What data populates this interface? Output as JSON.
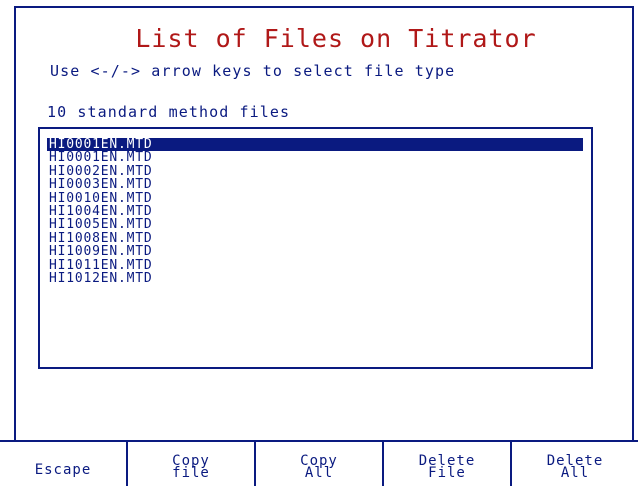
{
  "header": {
    "title": "List of Files on Titrator",
    "instructions": "Use <-/-> arrow keys to select file type"
  },
  "file_panel": {
    "count_label": "10 standard method files",
    "files": [
      "HI0001EN.MTD",
      "HI0001EN.MTD",
      "HI0002EN.MTD",
      "HI0003EN.MTD",
      "HI0010EN.MTD",
      "HI1004EN.MTD",
      "HI1005EN.MTD",
      "HI1008EN.MTD",
      "HI1009EN.MTD",
      "HI1011EN.MTD",
      "HI1012EN.MTD"
    ],
    "selected_index": 0
  },
  "softkeys": {
    "escape": {
      "label": "Escape"
    },
    "copy_file": {
      "line1": "Copy",
      "line2": "file"
    },
    "copy_all": {
      "line1": "Copy",
      "line2": "All"
    },
    "delete_file": {
      "line1": "Delete",
      "line2": "File"
    },
    "delete_all": {
      "line1": "Delete",
      "line2": "All"
    }
  },
  "colors": {
    "text": "#0a1a80",
    "title": "#b01818",
    "selection_bg": "#0a1a80",
    "selection_text": "#ffffff",
    "background": "#ffffff"
  }
}
